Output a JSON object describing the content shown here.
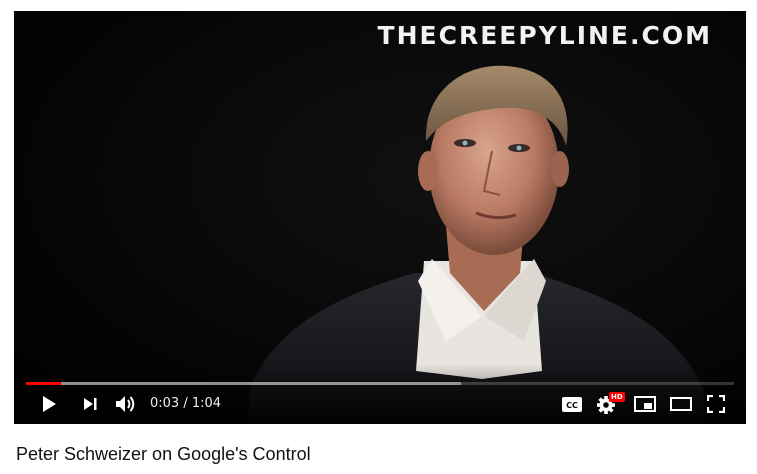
{
  "video": {
    "watermark": "THECREEPYLINE.COM",
    "current_time": "0:03",
    "duration": "1:04",
    "time_display": "0:03 / 1:04",
    "progress": {
      "played_fraction": 0.05,
      "loaded_fraction": 0.615,
      "played_color": "#ff0000"
    },
    "hd_badge": "HD",
    "icons": {
      "play": "play-icon",
      "next": "next-icon",
      "volume": "volume-icon",
      "captions": "captions-icon",
      "settings": "settings-icon",
      "miniplayer": "miniplayer-icon",
      "theater": "theater-mode-icon",
      "fullscreen": "fullscreen-icon"
    }
  },
  "title": "Peter Schweizer on Google's Control"
}
